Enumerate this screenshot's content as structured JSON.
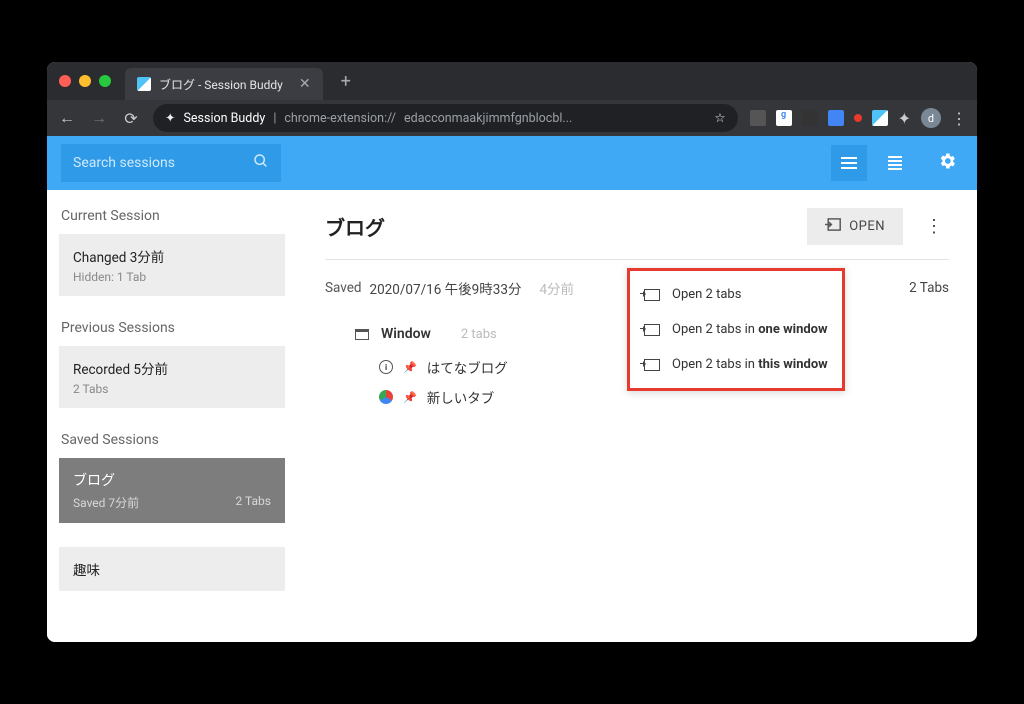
{
  "browser": {
    "tab_title": "ブログ - Session Buddy",
    "extension_name": "Session Buddy",
    "url_prefix": "chrome-extension://",
    "url_path": "edacconmaakjimmfgnblocbl...",
    "avatar_letter": "d"
  },
  "header": {
    "search_placeholder": "Search sessions"
  },
  "sidebar": {
    "current_title": "Current Session",
    "current": {
      "title": "Changed 3分前",
      "sub": "Hidden:  1 Tab"
    },
    "previous_title": "Previous Sessions",
    "previous": {
      "title": "Recorded 5分前",
      "sub": "2 Tabs"
    },
    "saved_title": "Saved Sessions",
    "saved_selected": {
      "title": "ブログ",
      "sub": "Saved 7分前",
      "count": "2 Tabs"
    },
    "saved_next": {
      "title": "趣味"
    }
  },
  "content": {
    "title": "ブログ",
    "open_label": "OPEN",
    "saved_label": "Saved",
    "saved_date": "2020/07/16 午後9時33分",
    "saved_ago": "4分前",
    "tabs_count": "2 Tabs",
    "window_label": "Window",
    "window_count": "2 tabs",
    "tabs": [
      {
        "title": "はてなブログ"
      },
      {
        "title": "新しいタブ"
      }
    ]
  },
  "context_menu": {
    "item1_a": "Open 2 tabs",
    "item2_a": "Open 2 tabs in ",
    "item2_b": "one window",
    "item3_a": "Open 2 tabs in ",
    "item3_b": "this window"
  }
}
